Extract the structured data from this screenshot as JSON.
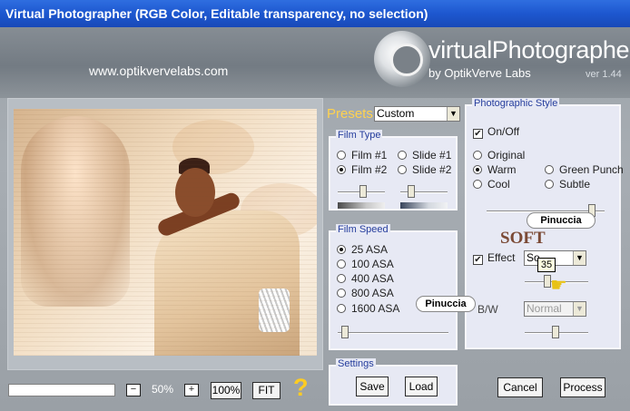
{
  "window": {
    "title": "Virtual Photographer (RGB Color, Editable transparency, no selection)"
  },
  "header": {
    "website": "www.optikvervelabs.com",
    "brand": "virtualPhotographer",
    "byline": "by OptikVerve Labs",
    "version": "ver 1.44"
  },
  "bottom_bar": {
    "zoom_out": "−",
    "zoom_value": "50%",
    "zoom_in": "+",
    "zoom_100": "100%",
    "fit": "FIT",
    "help": "?"
  },
  "presets": {
    "label": "Presets",
    "value": "Custom"
  },
  "film_type": {
    "title": "Film Type",
    "options": [
      "Film #1",
      "Slide #1",
      "Film #2",
      "Slide #2"
    ],
    "selected": "Film #2"
  },
  "film_speed": {
    "title": "Film Speed",
    "options": [
      "25 ASA",
      "100 ASA",
      "400 ASA",
      "800 ASA",
      "1600 ASA"
    ],
    "selected": "25 ASA"
  },
  "settings": {
    "title": "Settings",
    "save": "Save",
    "load": "Load"
  },
  "photographic_style": {
    "title": "Photographic Style",
    "onoff": "On/Off",
    "options": [
      "Original",
      "Warm",
      "Green Punch",
      "Cool",
      "Subtle"
    ],
    "selected": "Warm",
    "effect_label": "Effect",
    "effect_value": "So",
    "bw_label": "B/W",
    "bw_value": "Normal",
    "tooltip_value": "35"
  },
  "watermarks": {
    "pin1": "Pinuccia",
    "pin2": "Pinuccia",
    "soft": "SOFT"
  },
  "buttons": {
    "cancel": "Cancel",
    "process": "Process"
  },
  "colors": {
    "titlebar": "#1d57cf",
    "presets_label": "#ffd24f",
    "group_title": "#253d9d",
    "help": "#ffcc22"
  }
}
